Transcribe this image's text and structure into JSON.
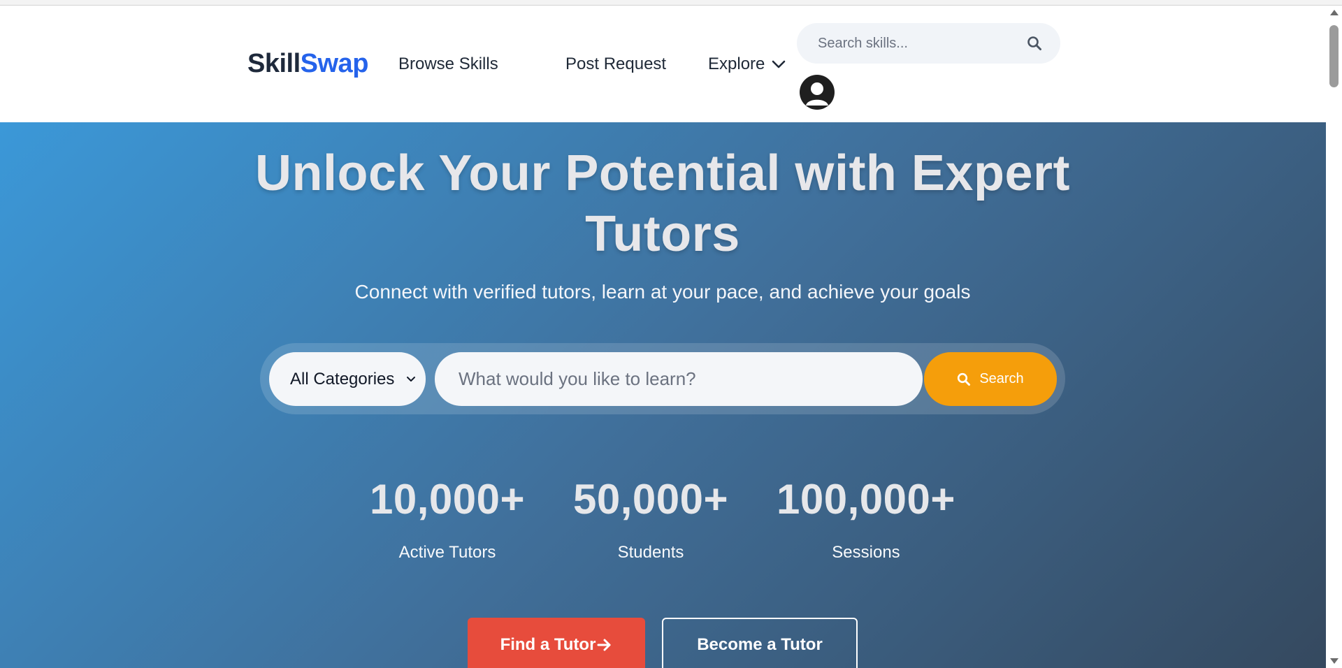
{
  "brand": {
    "part1": "Skill",
    "part2": "Swap"
  },
  "nav": {
    "browse": "Browse Skills",
    "post": "Post Request",
    "explore": "Explore"
  },
  "header_search": {
    "placeholder": "Search skills..."
  },
  "hero": {
    "title": "Unlock Your Potential with Expert Tutors",
    "subtitle": "Connect with verified tutors, learn at your pace, and achieve your goals",
    "category": "All Categories",
    "search_placeholder": "What would you like to learn?",
    "search_button": "Search"
  },
  "stats": [
    {
      "value": "10,000+",
      "label": "Active Tutors"
    },
    {
      "value": "50,000+",
      "label": "Students"
    },
    {
      "value": "100,000+",
      "label": "Sessions"
    }
  ],
  "cta": {
    "find": "Find a Tutor",
    "become": "Become a Tutor"
  },
  "colors": {
    "brand_dark": "#1e293b",
    "brand_accent": "#2563eb",
    "search_button": "#f59e0b",
    "find_button": "#e74c3c"
  },
  "icons": [
    "search-icon",
    "chevron-down-icon",
    "user-avatar-icon",
    "arrow-right-icon"
  ]
}
